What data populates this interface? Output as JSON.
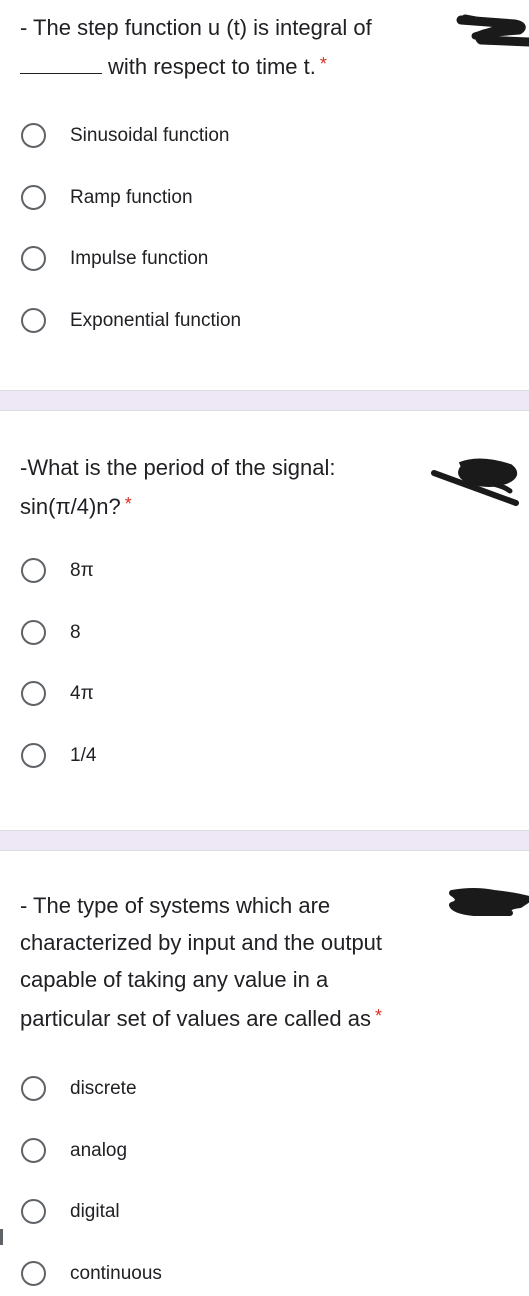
{
  "questions": [
    {
      "title_line1": "- The step function u (t) is integral of",
      "title_line2": "with respect to time t.",
      "has_blank": true,
      "required_mark": "*",
      "options": [
        {
          "label": "Sinusoidal function",
          "selected": false
        },
        {
          "label": "Ramp function",
          "selected": false
        },
        {
          "label": "Impulse function",
          "selected": false
        },
        {
          "label": "Exponential function",
          "selected": false
        }
      ]
    },
    {
      "title_line1": "-What is the period of the signal:",
      "title_line2": "sin(π/4)n?",
      "required_mark": "*",
      "options": [
        {
          "label": "8π",
          "selected": false
        },
        {
          "label": "8",
          "selected": false
        },
        {
          "label": "4π",
          "selected": false
        },
        {
          "label": "1/4",
          "selected": false
        }
      ]
    },
    {
      "title_lines": [
        "- The type of systems which are",
        "characterized by input and the output",
        "capable of taking any value in a",
        "particular set of values are called as"
      ],
      "required_mark": "*",
      "options": [
        {
          "label": "discrete",
          "selected": false
        },
        {
          "label": "analog",
          "selected": false
        },
        {
          "label": "digital",
          "selected": false
        },
        {
          "label": "continuous",
          "selected": false
        }
      ]
    }
  ],
  "colors": {
    "text": "#202124",
    "required": "#d93025",
    "radio_border": "#5f6368",
    "section_divider": "#ede7f6",
    "redaction": "#1a1a1a"
  },
  "decorations": {
    "redaction_marks": [
      "scribble-redaction",
      "scribble-redaction",
      "scribble-redaction"
    ]
  }
}
